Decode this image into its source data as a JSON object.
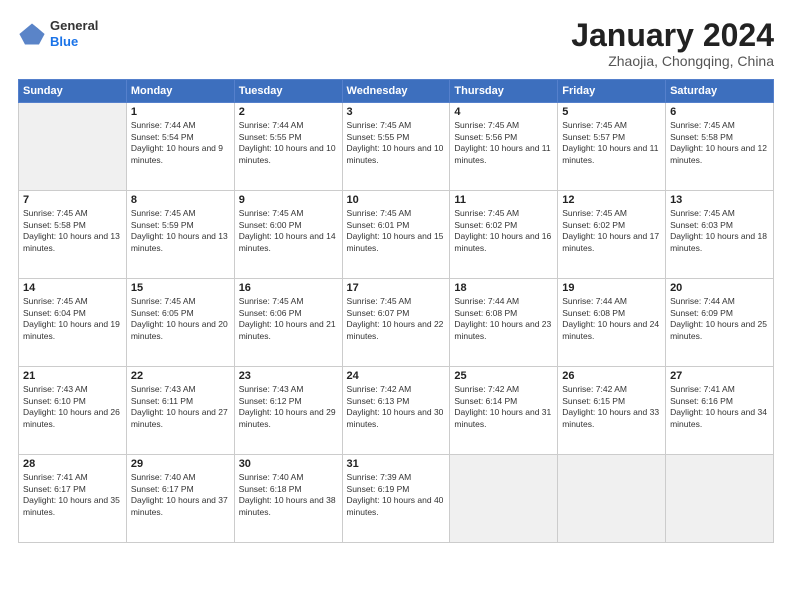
{
  "header": {
    "logo": {
      "line1": "General",
      "line2": "Blue"
    },
    "title": "January 2024",
    "location": "Zhaojia, Chongqing, China"
  },
  "days_of_week": [
    "Sunday",
    "Monday",
    "Tuesday",
    "Wednesday",
    "Thursday",
    "Friday",
    "Saturday"
  ],
  "weeks": [
    [
      {
        "day": "",
        "empty": true
      },
      {
        "day": "1",
        "sunrise": "Sunrise: 7:44 AM",
        "sunset": "Sunset: 5:54 PM",
        "daylight": "Daylight: 10 hours and 9 minutes."
      },
      {
        "day": "2",
        "sunrise": "Sunrise: 7:44 AM",
        "sunset": "Sunset: 5:55 PM",
        "daylight": "Daylight: 10 hours and 10 minutes."
      },
      {
        "day": "3",
        "sunrise": "Sunrise: 7:45 AM",
        "sunset": "Sunset: 5:55 PM",
        "daylight": "Daylight: 10 hours and 10 minutes."
      },
      {
        "day": "4",
        "sunrise": "Sunrise: 7:45 AM",
        "sunset": "Sunset: 5:56 PM",
        "daylight": "Daylight: 10 hours and 11 minutes."
      },
      {
        "day": "5",
        "sunrise": "Sunrise: 7:45 AM",
        "sunset": "Sunset: 5:57 PM",
        "daylight": "Daylight: 10 hours and 11 minutes."
      },
      {
        "day": "6",
        "sunrise": "Sunrise: 7:45 AM",
        "sunset": "Sunset: 5:58 PM",
        "daylight": "Daylight: 10 hours and 12 minutes."
      }
    ],
    [
      {
        "day": "7",
        "sunrise": "Sunrise: 7:45 AM",
        "sunset": "Sunset: 5:58 PM",
        "daylight": "Daylight: 10 hours and 13 minutes."
      },
      {
        "day": "8",
        "sunrise": "Sunrise: 7:45 AM",
        "sunset": "Sunset: 5:59 PM",
        "daylight": "Daylight: 10 hours and 13 minutes."
      },
      {
        "day": "9",
        "sunrise": "Sunrise: 7:45 AM",
        "sunset": "Sunset: 6:00 PM",
        "daylight": "Daylight: 10 hours and 14 minutes."
      },
      {
        "day": "10",
        "sunrise": "Sunrise: 7:45 AM",
        "sunset": "Sunset: 6:01 PM",
        "daylight": "Daylight: 10 hours and 15 minutes."
      },
      {
        "day": "11",
        "sunrise": "Sunrise: 7:45 AM",
        "sunset": "Sunset: 6:02 PM",
        "daylight": "Daylight: 10 hours and 16 minutes."
      },
      {
        "day": "12",
        "sunrise": "Sunrise: 7:45 AM",
        "sunset": "Sunset: 6:02 PM",
        "daylight": "Daylight: 10 hours and 17 minutes."
      },
      {
        "day": "13",
        "sunrise": "Sunrise: 7:45 AM",
        "sunset": "Sunset: 6:03 PM",
        "daylight": "Daylight: 10 hours and 18 minutes."
      }
    ],
    [
      {
        "day": "14",
        "sunrise": "Sunrise: 7:45 AM",
        "sunset": "Sunset: 6:04 PM",
        "daylight": "Daylight: 10 hours and 19 minutes."
      },
      {
        "day": "15",
        "sunrise": "Sunrise: 7:45 AM",
        "sunset": "Sunset: 6:05 PM",
        "daylight": "Daylight: 10 hours and 20 minutes."
      },
      {
        "day": "16",
        "sunrise": "Sunrise: 7:45 AM",
        "sunset": "Sunset: 6:06 PM",
        "daylight": "Daylight: 10 hours and 21 minutes."
      },
      {
        "day": "17",
        "sunrise": "Sunrise: 7:45 AM",
        "sunset": "Sunset: 6:07 PM",
        "daylight": "Daylight: 10 hours and 22 minutes."
      },
      {
        "day": "18",
        "sunrise": "Sunrise: 7:44 AM",
        "sunset": "Sunset: 6:08 PM",
        "daylight": "Daylight: 10 hours and 23 minutes."
      },
      {
        "day": "19",
        "sunrise": "Sunrise: 7:44 AM",
        "sunset": "Sunset: 6:08 PM",
        "daylight": "Daylight: 10 hours and 24 minutes."
      },
      {
        "day": "20",
        "sunrise": "Sunrise: 7:44 AM",
        "sunset": "Sunset: 6:09 PM",
        "daylight": "Daylight: 10 hours and 25 minutes."
      }
    ],
    [
      {
        "day": "21",
        "sunrise": "Sunrise: 7:43 AM",
        "sunset": "Sunset: 6:10 PM",
        "daylight": "Daylight: 10 hours and 26 minutes."
      },
      {
        "day": "22",
        "sunrise": "Sunrise: 7:43 AM",
        "sunset": "Sunset: 6:11 PM",
        "daylight": "Daylight: 10 hours and 27 minutes."
      },
      {
        "day": "23",
        "sunrise": "Sunrise: 7:43 AM",
        "sunset": "Sunset: 6:12 PM",
        "daylight": "Daylight: 10 hours and 29 minutes."
      },
      {
        "day": "24",
        "sunrise": "Sunrise: 7:42 AM",
        "sunset": "Sunset: 6:13 PM",
        "daylight": "Daylight: 10 hours and 30 minutes."
      },
      {
        "day": "25",
        "sunrise": "Sunrise: 7:42 AM",
        "sunset": "Sunset: 6:14 PM",
        "daylight": "Daylight: 10 hours and 31 minutes."
      },
      {
        "day": "26",
        "sunrise": "Sunrise: 7:42 AM",
        "sunset": "Sunset: 6:15 PM",
        "daylight": "Daylight: 10 hours and 33 minutes."
      },
      {
        "day": "27",
        "sunrise": "Sunrise: 7:41 AM",
        "sunset": "Sunset: 6:16 PM",
        "daylight": "Daylight: 10 hours and 34 minutes."
      }
    ],
    [
      {
        "day": "28",
        "sunrise": "Sunrise: 7:41 AM",
        "sunset": "Sunset: 6:17 PM",
        "daylight": "Daylight: 10 hours and 35 minutes."
      },
      {
        "day": "29",
        "sunrise": "Sunrise: 7:40 AM",
        "sunset": "Sunset: 6:17 PM",
        "daylight": "Daylight: 10 hours and 37 minutes."
      },
      {
        "day": "30",
        "sunrise": "Sunrise: 7:40 AM",
        "sunset": "Sunset: 6:18 PM",
        "daylight": "Daylight: 10 hours and 38 minutes."
      },
      {
        "day": "31",
        "sunrise": "Sunrise: 7:39 AM",
        "sunset": "Sunset: 6:19 PM",
        "daylight": "Daylight: 10 hours and 40 minutes."
      },
      {
        "day": "",
        "empty": true
      },
      {
        "day": "",
        "empty": true
      },
      {
        "day": "",
        "empty": true
      }
    ]
  ]
}
